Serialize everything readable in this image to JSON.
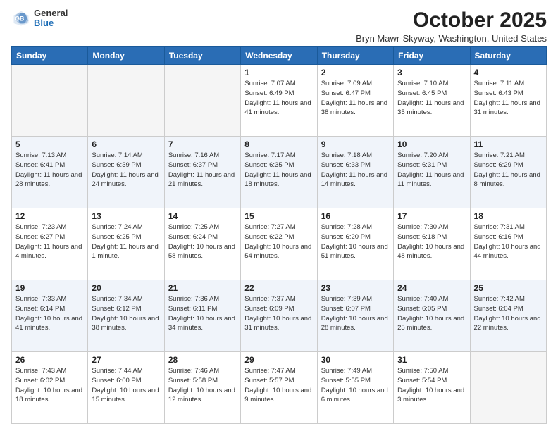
{
  "header": {
    "logo_general": "General",
    "logo_blue": "Blue",
    "month_title": "October 2025",
    "location": "Bryn Mawr-Skyway, Washington, United States"
  },
  "weekdays": [
    "Sunday",
    "Monday",
    "Tuesday",
    "Wednesday",
    "Thursday",
    "Friday",
    "Saturday"
  ],
  "weeks": [
    [
      {
        "day": "",
        "sunrise": "",
        "sunset": "",
        "daylight": "",
        "empty": true
      },
      {
        "day": "",
        "sunrise": "",
        "sunset": "",
        "daylight": "",
        "empty": true
      },
      {
        "day": "",
        "sunrise": "",
        "sunset": "",
        "daylight": "",
        "empty": true
      },
      {
        "day": "1",
        "sunrise": "Sunrise: 7:07 AM",
        "sunset": "Sunset: 6:49 PM",
        "daylight": "Daylight: 11 hours and 41 minutes.",
        "empty": false
      },
      {
        "day": "2",
        "sunrise": "Sunrise: 7:09 AM",
        "sunset": "Sunset: 6:47 PM",
        "daylight": "Daylight: 11 hours and 38 minutes.",
        "empty": false
      },
      {
        "day": "3",
        "sunrise": "Sunrise: 7:10 AM",
        "sunset": "Sunset: 6:45 PM",
        "daylight": "Daylight: 11 hours and 35 minutes.",
        "empty": false
      },
      {
        "day": "4",
        "sunrise": "Sunrise: 7:11 AM",
        "sunset": "Sunset: 6:43 PM",
        "daylight": "Daylight: 11 hours and 31 minutes.",
        "empty": false
      }
    ],
    [
      {
        "day": "5",
        "sunrise": "Sunrise: 7:13 AM",
        "sunset": "Sunset: 6:41 PM",
        "daylight": "Daylight: 11 hours and 28 minutes.",
        "empty": false
      },
      {
        "day": "6",
        "sunrise": "Sunrise: 7:14 AM",
        "sunset": "Sunset: 6:39 PM",
        "daylight": "Daylight: 11 hours and 24 minutes.",
        "empty": false
      },
      {
        "day": "7",
        "sunrise": "Sunrise: 7:16 AM",
        "sunset": "Sunset: 6:37 PM",
        "daylight": "Daylight: 11 hours and 21 minutes.",
        "empty": false
      },
      {
        "day": "8",
        "sunrise": "Sunrise: 7:17 AM",
        "sunset": "Sunset: 6:35 PM",
        "daylight": "Daylight: 11 hours and 18 minutes.",
        "empty": false
      },
      {
        "day": "9",
        "sunrise": "Sunrise: 7:18 AM",
        "sunset": "Sunset: 6:33 PM",
        "daylight": "Daylight: 11 hours and 14 minutes.",
        "empty": false
      },
      {
        "day": "10",
        "sunrise": "Sunrise: 7:20 AM",
        "sunset": "Sunset: 6:31 PM",
        "daylight": "Daylight: 11 hours and 11 minutes.",
        "empty": false
      },
      {
        "day": "11",
        "sunrise": "Sunrise: 7:21 AM",
        "sunset": "Sunset: 6:29 PM",
        "daylight": "Daylight: 11 hours and 8 minutes.",
        "empty": false
      }
    ],
    [
      {
        "day": "12",
        "sunrise": "Sunrise: 7:23 AM",
        "sunset": "Sunset: 6:27 PM",
        "daylight": "Daylight: 11 hours and 4 minutes.",
        "empty": false
      },
      {
        "day": "13",
        "sunrise": "Sunrise: 7:24 AM",
        "sunset": "Sunset: 6:25 PM",
        "daylight": "Daylight: 11 hours and 1 minute.",
        "empty": false
      },
      {
        "day": "14",
        "sunrise": "Sunrise: 7:25 AM",
        "sunset": "Sunset: 6:24 PM",
        "daylight": "Daylight: 10 hours and 58 minutes.",
        "empty": false
      },
      {
        "day": "15",
        "sunrise": "Sunrise: 7:27 AM",
        "sunset": "Sunset: 6:22 PM",
        "daylight": "Daylight: 10 hours and 54 minutes.",
        "empty": false
      },
      {
        "day": "16",
        "sunrise": "Sunrise: 7:28 AM",
        "sunset": "Sunset: 6:20 PM",
        "daylight": "Daylight: 10 hours and 51 minutes.",
        "empty": false
      },
      {
        "day": "17",
        "sunrise": "Sunrise: 7:30 AM",
        "sunset": "Sunset: 6:18 PM",
        "daylight": "Daylight: 10 hours and 48 minutes.",
        "empty": false
      },
      {
        "day": "18",
        "sunrise": "Sunrise: 7:31 AM",
        "sunset": "Sunset: 6:16 PM",
        "daylight": "Daylight: 10 hours and 44 minutes.",
        "empty": false
      }
    ],
    [
      {
        "day": "19",
        "sunrise": "Sunrise: 7:33 AM",
        "sunset": "Sunset: 6:14 PM",
        "daylight": "Daylight: 10 hours and 41 minutes.",
        "empty": false
      },
      {
        "day": "20",
        "sunrise": "Sunrise: 7:34 AM",
        "sunset": "Sunset: 6:12 PM",
        "daylight": "Daylight: 10 hours and 38 minutes.",
        "empty": false
      },
      {
        "day": "21",
        "sunrise": "Sunrise: 7:36 AM",
        "sunset": "Sunset: 6:11 PM",
        "daylight": "Daylight: 10 hours and 34 minutes.",
        "empty": false
      },
      {
        "day": "22",
        "sunrise": "Sunrise: 7:37 AM",
        "sunset": "Sunset: 6:09 PM",
        "daylight": "Daylight: 10 hours and 31 minutes.",
        "empty": false
      },
      {
        "day": "23",
        "sunrise": "Sunrise: 7:39 AM",
        "sunset": "Sunset: 6:07 PM",
        "daylight": "Daylight: 10 hours and 28 minutes.",
        "empty": false
      },
      {
        "day": "24",
        "sunrise": "Sunrise: 7:40 AM",
        "sunset": "Sunset: 6:05 PM",
        "daylight": "Daylight: 10 hours and 25 minutes.",
        "empty": false
      },
      {
        "day": "25",
        "sunrise": "Sunrise: 7:42 AM",
        "sunset": "Sunset: 6:04 PM",
        "daylight": "Daylight: 10 hours and 22 minutes.",
        "empty": false
      }
    ],
    [
      {
        "day": "26",
        "sunrise": "Sunrise: 7:43 AM",
        "sunset": "Sunset: 6:02 PM",
        "daylight": "Daylight: 10 hours and 18 minutes.",
        "empty": false
      },
      {
        "day": "27",
        "sunrise": "Sunrise: 7:44 AM",
        "sunset": "Sunset: 6:00 PM",
        "daylight": "Daylight: 10 hours and 15 minutes.",
        "empty": false
      },
      {
        "day": "28",
        "sunrise": "Sunrise: 7:46 AM",
        "sunset": "Sunset: 5:58 PM",
        "daylight": "Daylight: 10 hours and 12 minutes.",
        "empty": false
      },
      {
        "day": "29",
        "sunrise": "Sunrise: 7:47 AM",
        "sunset": "Sunset: 5:57 PM",
        "daylight": "Daylight: 10 hours and 9 minutes.",
        "empty": false
      },
      {
        "day": "30",
        "sunrise": "Sunrise: 7:49 AM",
        "sunset": "Sunset: 5:55 PM",
        "daylight": "Daylight: 10 hours and 6 minutes.",
        "empty": false
      },
      {
        "day": "31",
        "sunrise": "Sunrise: 7:50 AM",
        "sunset": "Sunset: 5:54 PM",
        "daylight": "Daylight: 10 hours and 3 minutes.",
        "empty": false
      },
      {
        "day": "",
        "sunrise": "",
        "sunset": "",
        "daylight": "",
        "empty": true
      }
    ]
  ]
}
